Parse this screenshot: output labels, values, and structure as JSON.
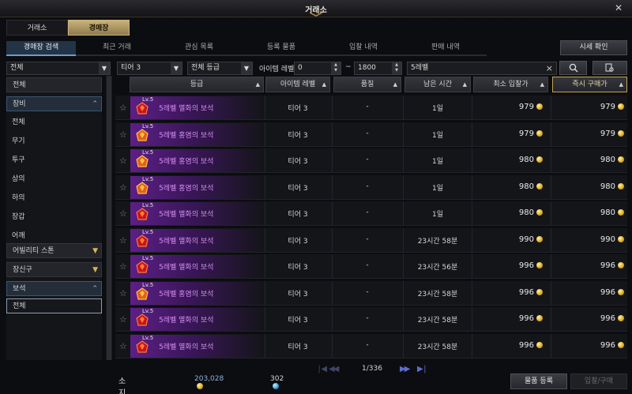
{
  "window": {
    "title": "거래소",
    "close_icon": "close-icon"
  },
  "main_tabs": [
    {
      "label": "거래소",
      "active": false
    },
    {
      "label": "경매장",
      "active": true
    }
  ],
  "sub_tabs": [
    {
      "label": "경매장 검색",
      "active": true
    },
    {
      "label": "최근 거래",
      "active": false
    },
    {
      "label": "관심 목록",
      "active": false
    },
    {
      "label": "등록 물품",
      "active": false
    },
    {
      "label": "입찰 내역",
      "active": false
    },
    {
      "label": "판매 내역",
      "active": false
    }
  ],
  "toolbar": {
    "price_check_label": "시세 확인"
  },
  "filters": {
    "category": "전체",
    "tier": "티어 3",
    "grade": "전체 등급",
    "item_level_label": "아이템 레벨",
    "level_min": "0",
    "level_sep": "~",
    "level_max": "1800",
    "search_text": "5레벨",
    "clear_icon": "×"
  },
  "sidebar": {
    "items": [
      {
        "label": "전체",
        "type": "cat"
      },
      {
        "label": "장비",
        "type": "cat-open"
      },
      {
        "label": "전체",
        "type": "sub"
      },
      {
        "label": "무기",
        "type": "sub"
      },
      {
        "label": "투구",
        "type": "sub"
      },
      {
        "label": "상의",
        "type": "sub"
      },
      {
        "label": "하의",
        "type": "sub"
      },
      {
        "label": "장갑",
        "type": "sub"
      },
      {
        "label": "어깨",
        "type": "sub"
      },
      {
        "label": "어빌리티 스톤",
        "type": "cat"
      },
      {
        "label": "장신구",
        "type": "cat"
      },
      {
        "label": "보석",
        "type": "cat-open"
      },
      {
        "label": "전체",
        "type": "sel"
      }
    ]
  },
  "table": {
    "headers": [
      "등급",
      "아이템 레벨",
      "품질",
      "남은 시간",
      "최소 입찰가",
      "즉시 구매가"
    ],
    "rows": [
      {
        "level": "Lv.5",
        "name": "5레벨 멸화의 보석",
        "gem": "red",
        "tier": "티어 3",
        "quality": "-",
        "time": "1일",
        "bid": "979",
        "buy": "979"
      },
      {
        "level": "Lv.5",
        "name": "5레벨 홍염의 보석",
        "gem": "orange",
        "tier": "티어 3",
        "quality": "-",
        "time": "1일",
        "bid": "979",
        "buy": "979"
      },
      {
        "level": "Lv.5",
        "name": "5레벨 홍염의 보석",
        "gem": "orange",
        "tier": "티어 3",
        "quality": "-",
        "time": "1일",
        "bid": "980",
        "buy": "980"
      },
      {
        "level": "Lv.5",
        "name": "5레벨 홍염의 보석",
        "gem": "orange",
        "tier": "티어 3",
        "quality": "-",
        "time": "1일",
        "bid": "980",
        "buy": "980"
      },
      {
        "level": "Lv.5",
        "name": "5레벨 멸화의 보석",
        "gem": "red",
        "tier": "티어 3",
        "quality": "-",
        "time": "1일",
        "bid": "980",
        "buy": "980"
      },
      {
        "level": "Lv.5",
        "name": "5레벨 멸화의 보석",
        "gem": "red",
        "tier": "티어 3",
        "quality": "-",
        "time": "23시간 58분",
        "bid": "990",
        "buy": "990"
      },
      {
        "level": "Lv.5",
        "name": "5레벨 멸화의 보석",
        "gem": "red",
        "tier": "티어 3",
        "quality": "-",
        "time": "23시간 56분",
        "bid": "996",
        "buy": "996"
      },
      {
        "level": "Lv.5",
        "name": "5레벨 홍염의 보석",
        "gem": "orange",
        "tier": "티어 3",
        "quality": "-",
        "time": "23시간 58분",
        "bid": "996",
        "buy": "996"
      },
      {
        "level": "Lv.5",
        "name": "5레벨 멸화의 보석",
        "gem": "red",
        "tier": "티어 3",
        "quality": "-",
        "time": "23시간 58분",
        "bid": "996",
        "buy": "996"
      },
      {
        "level": "Lv.5",
        "name": "5레벨 멸화의 보석",
        "gem": "red",
        "tier": "티어 3",
        "quality": "-",
        "time": "23시간 58분",
        "bid": "996",
        "buy": "996"
      }
    ]
  },
  "pagination": {
    "page_text": "1/336"
  },
  "footer": {
    "gold_label": "소지금",
    "gold_amount": "203,028",
    "crystal_amount": "302",
    "register_label": "물품 등록",
    "bid_buy_label": "입찰/구매"
  },
  "colors": {
    "accent_gold": "#c9b27a",
    "item_purple": "#d58ff0",
    "tab_blue": "#233447"
  }
}
